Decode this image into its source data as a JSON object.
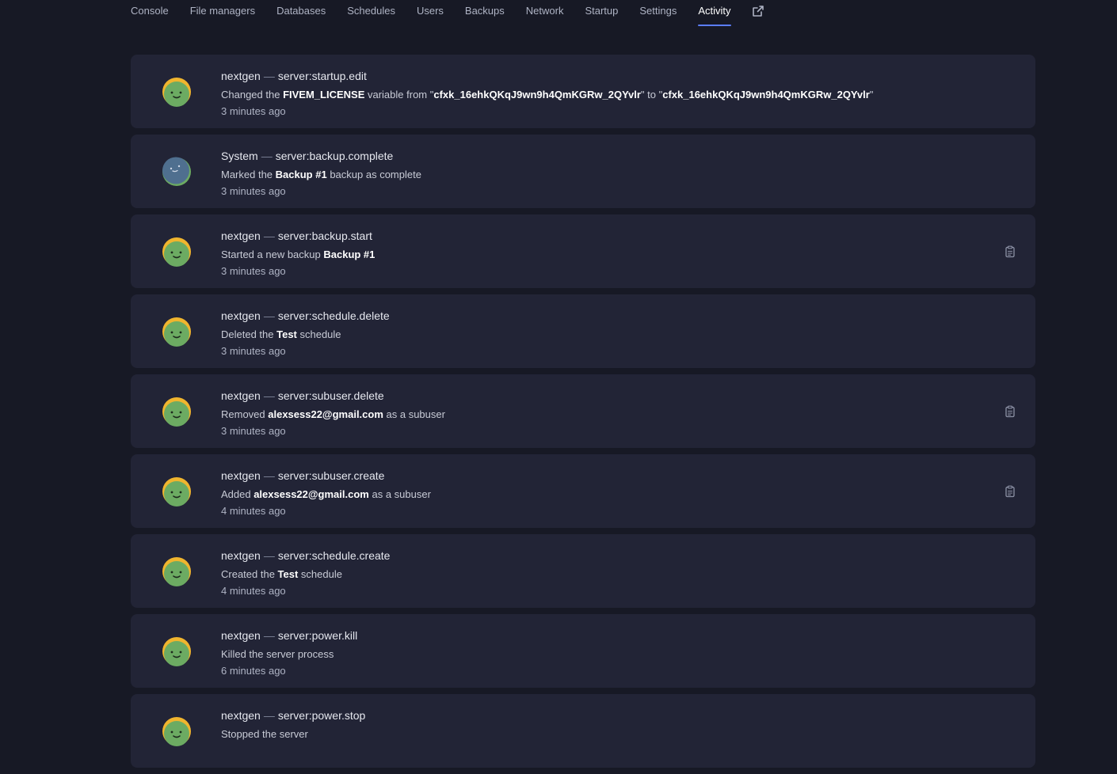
{
  "nav": {
    "tabs": [
      {
        "label": "Console"
      },
      {
        "label": "File managers"
      },
      {
        "label": "Databases"
      },
      {
        "label": "Schedules"
      },
      {
        "label": "Users"
      },
      {
        "label": "Backups"
      },
      {
        "label": "Network"
      },
      {
        "label": "Startup"
      },
      {
        "label": "Settings"
      },
      {
        "label": "Activity",
        "active": true
      }
    ],
    "external_icon": "external-link-icon"
  },
  "activity": [
    {
      "actor": "nextgen",
      "event": "server:startup.edit",
      "desc": [
        {
          "t": "Changed the "
        },
        {
          "t": "FIVEM_LICENSE",
          "b": true
        },
        {
          "t": " variable from \""
        },
        {
          "t": "cfxk_16ehkQKqJ9wn9h4QmKGRw_2QYvlr",
          "b": true
        },
        {
          "t": "\" to \""
        },
        {
          "t": "cfxk_16ehkQKqJ9wn9h4QmKGRw_2QYvlr",
          "b": true
        },
        {
          "t": "\""
        }
      ],
      "time": "3 minutes ago",
      "avatar": "user",
      "clipboard": false
    },
    {
      "actor": "System",
      "event": "server:backup.complete",
      "desc": [
        {
          "t": "Marked the "
        },
        {
          "t": "Backup #1",
          "b": true
        },
        {
          "t": " backup as complete"
        }
      ],
      "time": "3 minutes ago",
      "avatar": "system",
      "clipboard": false
    },
    {
      "actor": "nextgen",
      "event": "server:backup.start",
      "desc": [
        {
          "t": "Started a new backup "
        },
        {
          "t": "Backup #1",
          "b": true
        }
      ],
      "time": "3 minutes ago",
      "avatar": "user",
      "clipboard": true
    },
    {
      "actor": "nextgen",
      "event": "server:schedule.delete",
      "desc": [
        {
          "t": "Deleted the "
        },
        {
          "t": "Test",
          "b": true
        },
        {
          "t": " schedule"
        }
      ],
      "time": "3 minutes ago",
      "avatar": "user",
      "clipboard": false
    },
    {
      "actor": "nextgen",
      "event": "server:subuser.delete",
      "desc": [
        {
          "t": "Removed "
        },
        {
          "t": "alexsess22@gmail.com",
          "b": true
        },
        {
          "t": " as a subuser"
        }
      ],
      "time": "3 minutes ago",
      "avatar": "user",
      "clipboard": true
    },
    {
      "actor": "nextgen",
      "event": "server:subuser.create",
      "desc": [
        {
          "t": "Added "
        },
        {
          "t": "alexsess22@gmail.com",
          "b": true
        },
        {
          "t": " as a subuser"
        }
      ],
      "time": "4 minutes ago",
      "avatar": "user",
      "clipboard": true
    },
    {
      "actor": "nextgen",
      "event": "server:schedule.create",
      "desc": [
        {
          "t": "Created the "
        },
        {
          "t": "Test",
          "b": true
        },
        {
          "t": " schedule"
        }
      ],
      "time": "4 minutes ago",
      "avatar": "user",
      "clipboard": false
    },
    {
      "actor": "nextgen",
      "event": "server:power.kill",
      "desc": [
        {
          "t": "Killed the server process"
        }
      ],
      "time": "6 minutes ago",
      "avatar": "user",
      "clipboard": false
    },
    {
      "actor": "nextgen",
      "event": "server:power.stop",
      "desc": [
        {
          "t": "Stopped the server"
        }
      ],
      "time": "",
      "avatar": "user",
      "clipboard": false
    }
  ],
  "colors": {
    "background": "#171925",
    "card": "#222436",
    "accent": "#5b7dff",
    "avatar_user_face": "#6cab62",
    "avatar_user_hair": "#f0b52e",
    "avatar_system_face": "#4f6f8f"
  },
  "icons": {
    "clipboard": "clipboard-icon"
  }
}
